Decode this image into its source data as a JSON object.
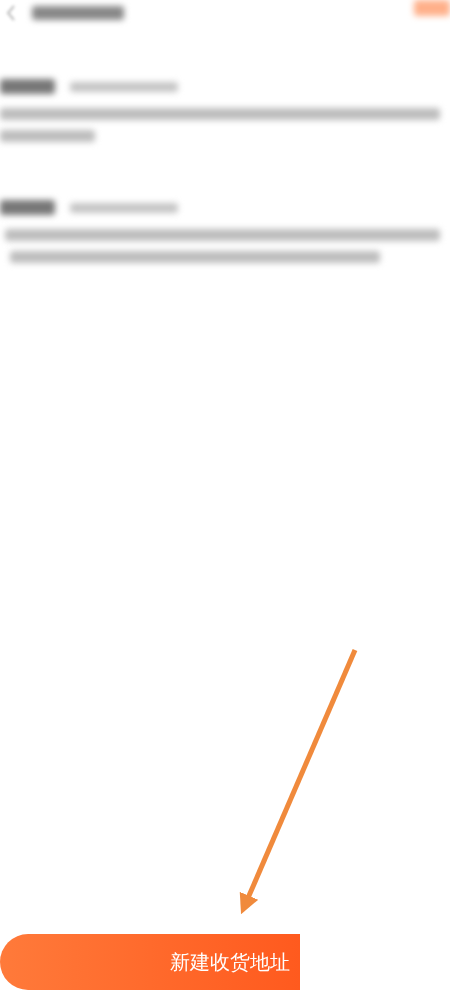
{
  "button": {
    "label": "新建收货地址"
  }
}
